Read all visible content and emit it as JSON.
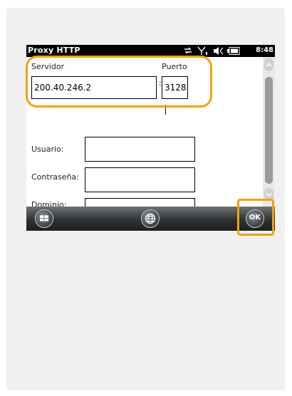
{
  "window": {
    "title": "Proxy HTTP",
    "clock": "8:48"
  },
  "form": {
    "server_label": "Servidor",
    "server_value": "200.40.246.2",
    "port_label": "Puerto",
    "port_value": "3128",
    "separator": ":",
    "user_label": "Usuario:",
    "user_value": "",
    "password_label": "Contraseña:",
    "password_value": "",
    "domain_label": "Dominio:",
    "domain_value": ""
  },
  "taskbar": {
    "ok_label": "OK"
  },
  "icons": [
    "connectivity-icon",
    "signal-icon",
    "volume-icon",
    "battery-icon",
    "windows-start-icon",
    "globe-icon",
    "ok-icon",
    "scroll-up-icon",
    "scroll-down-icon"
  ],
  "colors": {
    "highlight": "#f0a30a",
    "statusbar": "#000000",
    "taskbar": "#2f3235"
  }
}
